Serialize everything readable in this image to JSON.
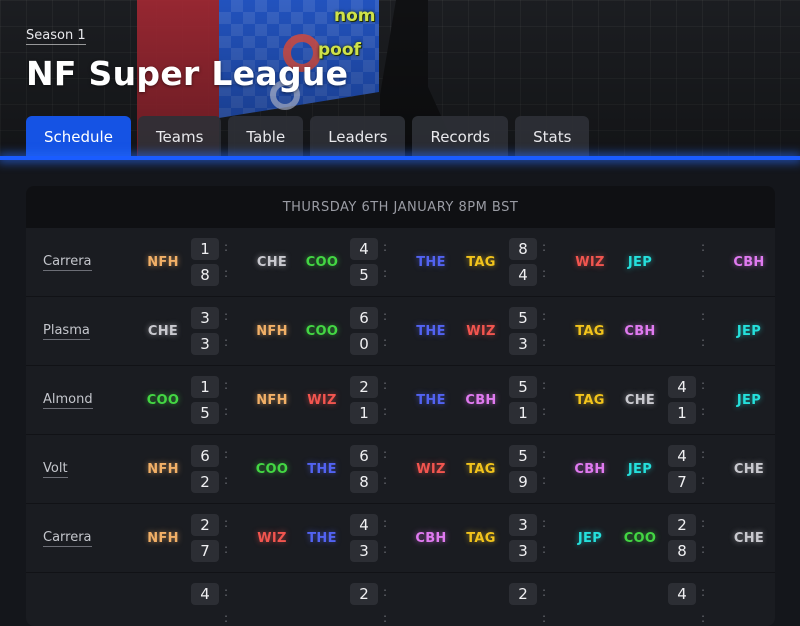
{
  "header": {
    "season": "Season 1",
    "title": "NF Super League",
    "art_tags": [
      "nom",
      "poof"
    ]
  },
  "tabs": [
    {
      "label": "Schedule",
      "active": true
    },
    {
      "label": "Teams",
      "active": false
    },
    {
      "label": "Table",
      "active": false
    },
    {
      "label": "Leaders",
      "active": false
    },
    {
      "label": "Records",
      "active": false
    },
    {
      "label": "Stats",
      "active": false
    }
  ],
  "schedule": {
    "date_header": "THURSDAY 6TH JANUARY 8PM BST",
    "rows": [
      {
        "venue": "Carrera",
        "games": [
          {
            "home": "NFH",
            "away": "CHE",
            "home_score": "1",
            "away_score": "8"
          },
          {
            "home": "COO",
            "away": "THE",
            "home_score": "4",
            "away_score": "5"
          },
          {
            "home": "TAG",
            "away": "WIZ",
            "home_score": "8",
            "away_score": "4"
          },
          {
            "home": "JEP",
            "away": "CBH",
            "home_score": "",
            "away_score": ""
          }
        ]
      },
      {
        "venue": "Plasma",
        "games": [
          {
            "home": "CHE",
            "away": "NFH",
            "home_score": "3",
            "away_score": "3"
          },
          {
            "home": "COO",
            "away": "THE",
            "home_score": "6",
            "away_score": "0"
          },
          {
            "home": "WIZ",
            "away": "TAG",
            "home_score": "5",
            "away_score": "3"
          },
          {
            "home": "CBH",
            "away": "JEP",
            "home_score": "",
            "away_score": ""
          }
        ]
      },
      {
        "venue": "Almond",
        "games": [
          {
            "home": "COO",
            "away": "NFH",
            "home_score": "1",
            "away_score": "5"
          },
          {
            "home": "WIZ",
            "away": "THE",
            "home_score": "2",
            "away_score": "1"
          },
          {
            "home": "CBH",
            "away": "TAG",
            "home_score": "5",
            "away_score": "1"
          },
          {
            "home": "CHE",
            "away": "JEP",
            "home_score": "4",
            "away_score": "1"
          }
        ]
      },
      {
        "venue": "Volt",
        "games": [
          {
            "home": "NFH",
            "away": "COO",
            "home_score": "6",
            "away_score": "2"
          },
          {
            "home": "THE",
            "away": "WIZ",
            "home_score": "6",
            "away_score": "8"
          },
          {
            "home": "TAG",
            "away": "CBH",
            "home_score": "5",
            "away_score": "9"
          },
          {
            "home": "JEP",
            "away": "CHE",
            "home_score": "4",
            "away_score": "7"
          }
        ]
      },
      {
        "venue": "Carrera",
        "games": [
          {
            "home": "NFH",
            "away": "WIZ",
            "home_score": "2",
            "away_score": "7"
          },
          {
            "home": "THE",
            "away": "CBH",
            "home_score": "4",
            "away_score": "3"
          },
          {
            "home": "TAG",
            "away": "JEP",
            "home_score": "3",
            "away_score": "3"
          },
          {
            "home": "COO",
            "away": "CHE",
            "home_score": "2",
            "away_score": "8"
          }
        ]
      },
      {
        "venue": "",
        "games": [
          {
            "home": "",
            "away": "",
            "home_score": "4",
            "away_score": ""
          },
          {
            "home": "",
            "away": "",
            "home_score": "2",
            "away_score": ""
          },
          {
            "home": "",
            "away": "",
            "home_score": "2",
            "away_score": ""
          },
          {
            "home": "",
            "away": "",
            "home_score": "4",
            "away_score": ""
          }
        ]
      }
    ]
  },
  "team_colors": {
    "NFH": "#f2b067",
    "CHE": "#c9c9cf",
    "COO": "#43d643",
    "THE": "#5263f2",
    "TAG": "#f2c41c",
    "WIZ": "#f2554f",
    "JEP": "#25e0dc",
    "CBH": "#e07af0"
  },
  "colors": {
    "accent": "#1553e4",
    "background": "#14161b",
    "card": "#1a1c21"
  }
}
